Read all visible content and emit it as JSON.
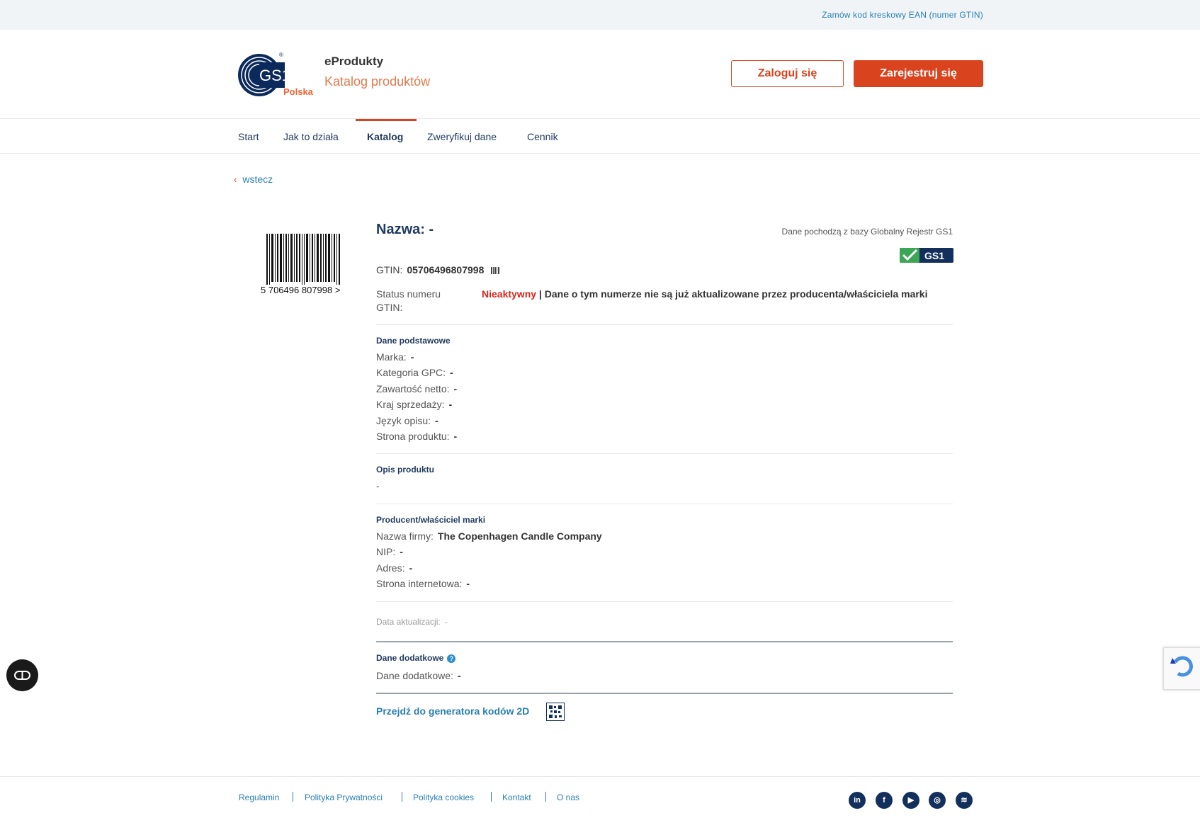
{
  "topbar": {
    "order_link": "Zamów kod kreskowy EAN (numer GTIN)"
  },
  "header": {
    "logo_text": "GS1",
    "logo_sub": "Polska",
    "brand_title": "eProdukty",
    "brand_subtitle": "Katalog produktów",
    "login_label": "Zaloguj się",
    "register_label": "Zarejestruj się"
  },
  "nav": {
    "items": [
      {
        "label": "Start"
      },
      {
        "label": "Jak to działa"
      },
      {
        "label": "Katalog",
        "active": true
      },
      {
        "label": "Zweryfikuj dane"
      },
      {
        "label": "Cennik"
      }
    ]
  },
  "back_label": "wstecz",
  "product": {
    "barcode_text": "5 706496 807998 >",
    "title": "Nazwa: -",
    "source": "Dane pochodzą z bazy Globalny Rejestr GS1",
    "badge": "GS1",
    "gtin_label": "GTIN:",
    "gtin_value": "05706496807998",
    "status_label": "Status numeru GTIN:",
    "status_value": "Nieaktywny",
    "status_desc": " | Dane o tym numerze nie są już aktualizowane przez producenta/właściciela marki"
  },
  "basic": {
    "title": "Dane podstawowe",
    "fields": [
      {
        "label": "Marka:",
        "value": "-"
      },
      {
        "label": "Kategoria GPC:",
        "value": "-"
      },
      {
        "label": "Zawartość netto:",
        "value": "-"
      },
      {
        "label": "Kraj sprzedaży:",
        "value": "-"
      },
      {
        "label": "Język opisu:",
        "value": "-"
      },
      {
        "label": "Strona produktu:",
        "value": "-"
      }
    ]
  },
  "description": {
    "title": "Opis produktu",
    "value": "-"
  },
  "producer": {
    "title": "Producent/właściciel marki",
    "fields": [
      {
        "label": "Nazwa firmy:",
        "value": "The Copenhagen Candle Company"
      },
      {
        "label": "NIP:",
        "value": "-"
      },
      {
        "label": "Adres:",
        "value": "-"
      },
      {
        "label": "Strona internetowa:",
        "value": "-"
      }
    ]
  },
  "update": {
    "label": "Data aktualizacji:",
    "value": "-"
  },
  "additional": {
    "title": "Dane dodatkowe",
    "help": "?",
    "label": "Dane dodatkowe:",
    "value": "-"
  },
  "generator_link": "Przejdź do generatora kodów 2D",
  "footer": {
    "links": [
      "Regulamin",
      "Polityka Prywatności",
      "Polityka cookies",
      "Kontakt",
      "O nas"
    ],
    "social": [
      "linkedin-icon",
      "facebook-icon",
      "youtube-icon",
      "instagram-icon",
      "spotify-icon"
    ]
  },
  "colors": {
    "accent": "#d9441f",
    "navy": "#1f3a5f",
    "link": "#2a7fb5",
    "inactive": "#d9251d"
  }
}
